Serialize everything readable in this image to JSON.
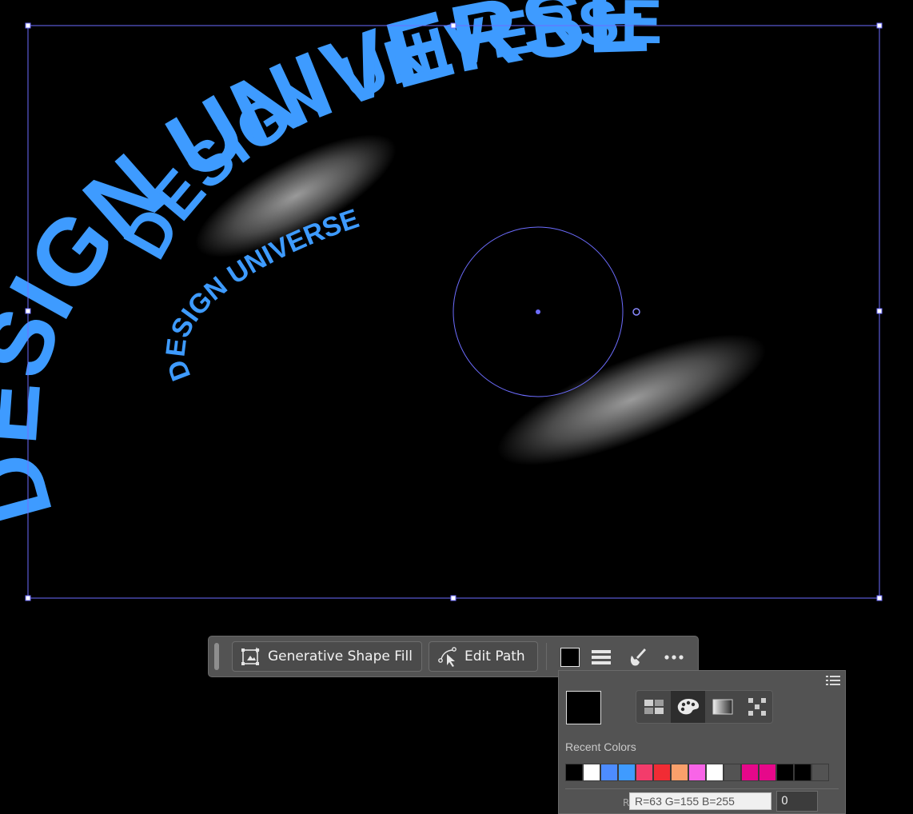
{
  "artwork": {
    "text_line_1": "DESIGN UNIVERSE",
    "text_line_2": "DESIGN UNIVERSE",
    "text_color": "#3e9bff",
    "selection_color": "#6d6dff"
  },
  "taskbar": {
    "generative_shape_fill": "Generative Shape Fill",
    "edit_path": "Edit Path",
    "fill_color": "#000000",
    "icons": [
      "generative-fill-icon",
      "pen-path-icon",
      "stroke-lines-icon",
      "brush-icon",
      "more-icon"
    ]
  },
  "color_panel": {
    "current_color": "#000000",
    "modes": [
      "swatches-icon",
      "color-picker-icon",
      "gradient-icon",
      "pattern-icon"
    ],
    "active_mode": "color-picker-icon",
    "recent_colors_label": "Recent Colors",
    "recent_colors": [
      "#000000",
      "#ffffff",
      "#4d8cff",
      "#3f9bff",
      "#f33c6b",
      "#f12c34",
      "#f9a06b",
      "#f864e7",
      "#ffffff",
      "#535353",
      "#e6088a",
      "#e6088a",
      "#000000",
      "#000000",
      "#535353"
    ],
    "tooltip": "R=63 G=155 B=255",
    "tooltip_prefix": "R",
    "value_field": "0"
  }
}
